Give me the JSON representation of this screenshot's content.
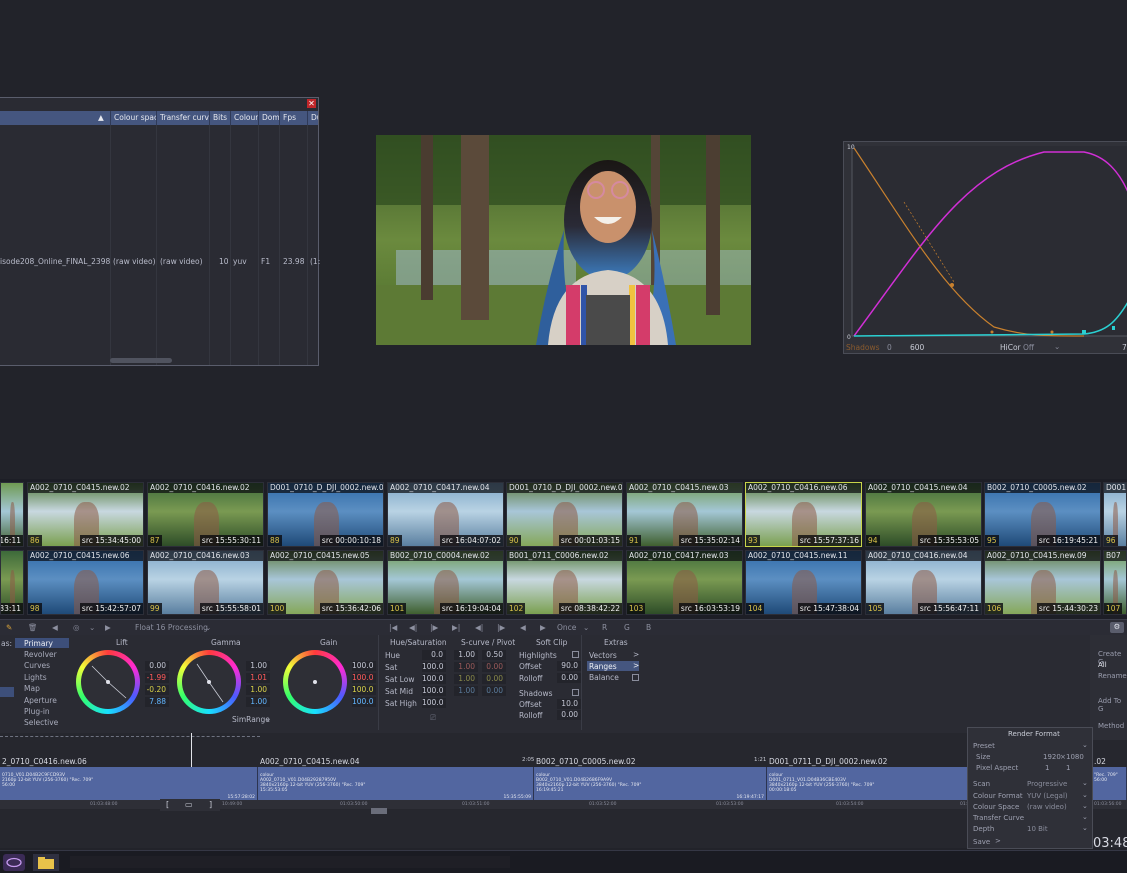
{
  "metadata_panel": {
    "close_icon": "close-icon",
    "columns": [
      "Colour space",
      "Transfer curve",
      "Bits",
      "Colour",
      "Domi",
      "Fps",
      "Du"
    ],
    "row": {
      "name": "isode208_Online_FINAL_2398",
      "colour_space": "(raw video)",
      "transfer_curve": "(raw video)",
      "bits": "10",
      "colour": "yuv",
      "domi": "F1",
      "fps": "23.98",
      "du": "(1:"
    }
  },
  "curve_panel": {
    "y_top": "10",
    "y_bottom": "0",
    "shadows_label": "Shadows",
    "shadows_value": "0",
    "value_600": "600",
    "hicor_label": "HiCor",
    "hicor_value": "Off",
    "right_value": "7"
  },
  "thumbnails": {
    "row1": [
      {
        "name": "",
        "num": "",
        "src": "16:11"
      },
      {
        "name": "A002_0710_C0415.new.02",
        "num": "86",
        "src": "src 15:34:45:00"
      },
      {
        "name": "A002_0710_C0416.new.02",
        "num": "87",
        "src": "src 15:55:30:11"
      },
      {
        "name": "D001_0710_D_DJI_0002.new.03",
        "num": "88",
        "src": "src 00:00:10:18"
      },
      {
        "name": "A002_0710_C0417.new.04",
        "num": "89",
        "src": "src 16:04:07:02"
      },
      {
        "name": "D001_0710_D_DJI_0002.new.03",
        "num": "90",
        "src": "src 00:01:03:15"
      },
      {
        "name": "A002_0710_C0415.new.03",
        "num": "91",
        "src": "src 15:35:02:14"
      },
      {
        "name": "A002_0710_C0416.new.06",
        "num": "93",
        "src": "src 15:57:37:16"
      },
      {
        "name": "A002_0710_C0415.new.04",
        "num": "94",
        "src": "src 15:35:53:05"
      },
      {
        "name": "B002_0710_C0005.new.02",
        "num": "95",
        "src": "src 16:19:45:21"
      },
      {
        "name": "D001",
        "num": "96",
        "src": ""
      }
    ],
    "row2": [
      {
        "name": "",
        "num": "",
        "src": "33:11"
      },
      {
        "name": "A002_0710_C0415.new.06",
        "num": "98",
        "src": "src 15:42:57:07"
      },
      {
        "name": "A002_0710_C0416.new.03",
        "num": "99",
        "src": "src 15:55:58:01"
      },
      {
        "name": "A002_0710_C0415.new.05",
        "num": "100",
        "src": "src 15:36:42:06"
      },
      {
        "name": "B002_0710_C0004.new.02",
        "num": "101",
        "src": "src 16:19:04:04"
      },
      {
        "name": "B001_0711_C0006.new.02",
        "num": "102",
        "src": "src 08:38:42:22"
      },
      {
        "name": "A002_0710_C0417.new.03",
        "num": "103",
        "src": "src 16:03:53:19"
      },
      {
        "name": "A002_0710_C0415.new.11",
        "num": "104",
        "src": "src 15:47:38:04"
      },
      {
        "name": "A002_0710_C0416.new.04",
        "num": "105",
        "src": "src 15:56:47:11"
      },
      {
        "name": "A002_0710_C0415.new.09",
        "num": "106",
        "src": "src 15:44:30:23"
      },
      {
        "name": "B07",
        "num": "107",
        "src": ""
      }
    ]
  },
  "toolbar": {
    "processing": "Float 16 Processing",
    "once": "Once",
    "r": "R",
    "g": "G",
    "b": "B"
  },
  "grade": {
    "menu_prefix": "as:",
    "menu": [
      "Primary",
      "Revolver",
      "Curves",
      "Lights",
      "Map",
      "Aperture",
      "Plug-in",
      "Selective"
    ],
    "lift": {
      "title": "Lift",
      "values": [
        "0.00",
        "-1.99",
        "-0.20",
        "7.88"
      ]
    },
    "gamma": {
      "title": "Gamma",
      "values": [
        "1.00",
        "1.01",
        "1.00",
        "1.00"
      ],
      "range": "SimRange"
    },
    "gain": {
      "title": "Gain",
      "values": [
        "100.0",
        "100.0",
        "100.0",
        "100.0"
      ]
    },
    "hue_sat": {
      "title": "Hue/Saturation",
      "labels": [
        "Hue",
        "Sat",
        "Sat Low",
        "Sat Mid",
        "Sat High"
      ],
      "values": [
        "0.0",
        "100.0",
        "100.0",
        "100.0",
        "100.0"
      ]
    },
    "scurve": {
      "title": "S-curve / Pivot",
      "col1": [
        "1.00",
        "1.00",
        "1.00",
        "1.00"
      ],
      "col2": [
        "0.50",
        "0.00",
        "0.00",
        "0.00"
      ]
    },
    "softclip": {
      "title": "Soft Clip",
      "highlights": "Highlights",
      "offset": "Offset",
      "offset_val": "90.0",
      "rolloff": "Rolloff",
      "rolloff_val": "0.00",
      "shadows": "Shadows",
      "offset2_val": "10.0",
      "rolloff2_val": "0.00"
    },
    "extras": {
      "title": "Extras",
      "items": [
        "Vectors",
        "Ranges",
        "Balance"
      ]
    }
  },
  "timeline": {
    "clips": [
      {
        "title": "2_0710_C0416.new.06",
        "info": [
          "0710_V01.D04B2C9FCD93V",
          "2160p 12-bit YUV (256-3760) \"Rec. 709\"",
          "56:00"
        ],
        "end": "15:57:28:02"
      },
      {
        "title": "A002_0710_C0415.new.04",
        "info": [
          "colour",
          "A002_0710_V01.D04B29287950V",
          "3840x2160p 12-bit YUV (256-3760) \"Rec. 709\"",
          "15:35:53:05"
        ],
        "end": "15:35:55:09"
      },
      {
        "title": "B002_0710_C0005.new.02",
        "info": [
          "colour",
          "B002_0710_V01.D04B2686F9A9V",
          "3840x2160p 12-bit YUV (256-3760) \"Rec. 709\"",
          "16:19:45:21"
        ],
        "end": "16:19:47:17"
      },
      {
        "title": "D001_0711_D_DJI_0002.new.02",
        "info": [
          "colour",
          "D001_0711_V01.D04B36CBE403V",
          "3840x2160p 12-bit YUV (256-3760) \"Rec. 709\"",
          "00:00:18:05"
        ],
        "end": ""
      },
      {
        "title": ".02",
        "info": [
          "",
          "",
          "\"Rec. 709\"",
          "56:00"
        ],
        "end": ""
      }
    ],
    "durations": [
      "2:05",
      "1:21"
    ],
    "ruler": [
      "01:03:48:00",
      "10:49:00",
      "01:03:50:00",
      "01:03:51:00",
      "01:03:52:00",
      "01:03:53:00",
      "01:03:54:00",
      "01:03:55:00",
      "01:03:56:00"
    ],
    "brackets": [
      "[",
      "▭",
      "]"
    ]
  },
  "render_format": {
    "title": "Render Format",
    "preset": "Preset",
    "size": "Size",
    "width": "1920",
    "x": "×",
    "height": "1080",
    "pixel_aspect": "Pixel Aspect",
    "pa1": "1",
    "pa2": "1",
    "scan": "Scan",
    "scan_val": "Progressive",
    "colour_format": "Colour Format",
    "colour_format_val": "YUV (Legal)",
    "colour_space": "Colour Space",
    "colour_space_val": "(raw video)",
    "transfer_curve": "Transfer Curve",
    "depth": "Depth",
    "depth_val": "10 Bit",
    "save": "Save"
  },
  "side_panel": {
    "create": "Create G",
    "all": "All",
    "rename": "Rename",
    "add": "Add To G",
    "method": "Method"
  },
  "clock": "03:48",
  "colors": {
    "accent_blue": "#45567f",
    "clip_blue": "#5266a0",
    "selected_thumb": "#c8d44a",
    "curve_magenta": "#d12fd6",
    "curve_cyan": "#2ad0d2",
    "curve_orange": "#c9812e"
  }
}
